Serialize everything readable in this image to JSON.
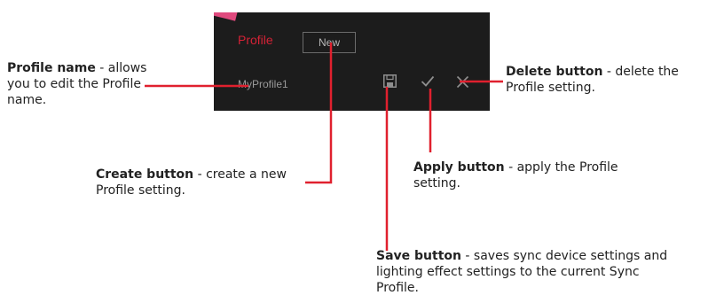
{
  "panel": {
    "profile_label": "Profile",
    "new_button_label": "New",
    "profile_name_value": "MyProfile1",
    "icons": {
      "save": "floppy-disk-icon",
      "apply": "checkmark-icon",
      "delete": "close-x-icon"
    },
    "colors": {
      "background": "#1c1c1c",
      "accent": "#d42236",
      "icon": "#8f8f8f"
    }
  },
  "callouts": {
    "profile_name": {
      "title": "Profile name",
      "text": " - allows you to edit the Profile name."
    },
    "delete": {
      "title": "Delete button",
      "text": " - delete the Profile setting."
    },
    "create": {
      "title": "Create button",
      "text": " - create a new Profile setting."
    },
    "apply": {
      "title": "Apply button",
      "text": " - apply the Profile setting."
    },
    "save": {
      "title": "Save button",
      "text": " - saves sync device settings and lighting effect settings to the current Sync Profile."
    }
  },
  "leader_color": "#e0202e"
}
